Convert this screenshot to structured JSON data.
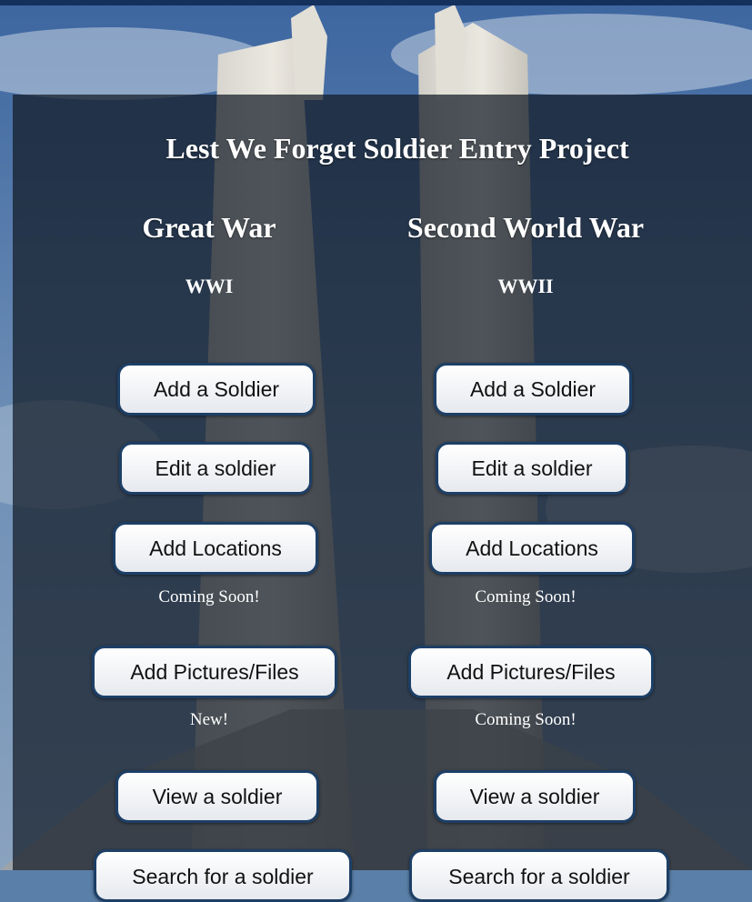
{
  "page": {
    "title": "Lest We Forget Soldier Entry Project"
  },
  "wwi": {
    "heading": "Great War",
    "subheading": "WWI",
    "buttons": {
      "add_soldier": "Add a Soldier",
      "edit_soldier": "Edit a soldier",
      "add_locations": "Add Locations",
      "add_pictures": "Add Pictures/Files",
      "view_soldier": "View a soldier",
      "search_soldier": "Search for a soldier"
    },
    "notes": {
      "locations": "Coming Soon!",
      "pictures": "New!"
    }
  },
  "wwii": {
    "heading": "Second World War",
    "subheading": "WWII",
    "buttons": {
      "add_soldier": "Add a Soldier",
      "edit_soldier": "Edit a soldier",
      "add_locations": "Add Locations",
      "add_pictures": "Add Pictures/Files",
      "view_soldier": "View a soldier",
      "search_soldier": "Search for a soldier"
    },
    "notes": {
      "locations": "Coming Soon!",
      "pictures": "Coming Soon!"
    }
  },
  "colors": {
    "panel": "#121a26",
    "button_border": "#1d3f66",
    "top_bar": "#14305c"
  }
}
